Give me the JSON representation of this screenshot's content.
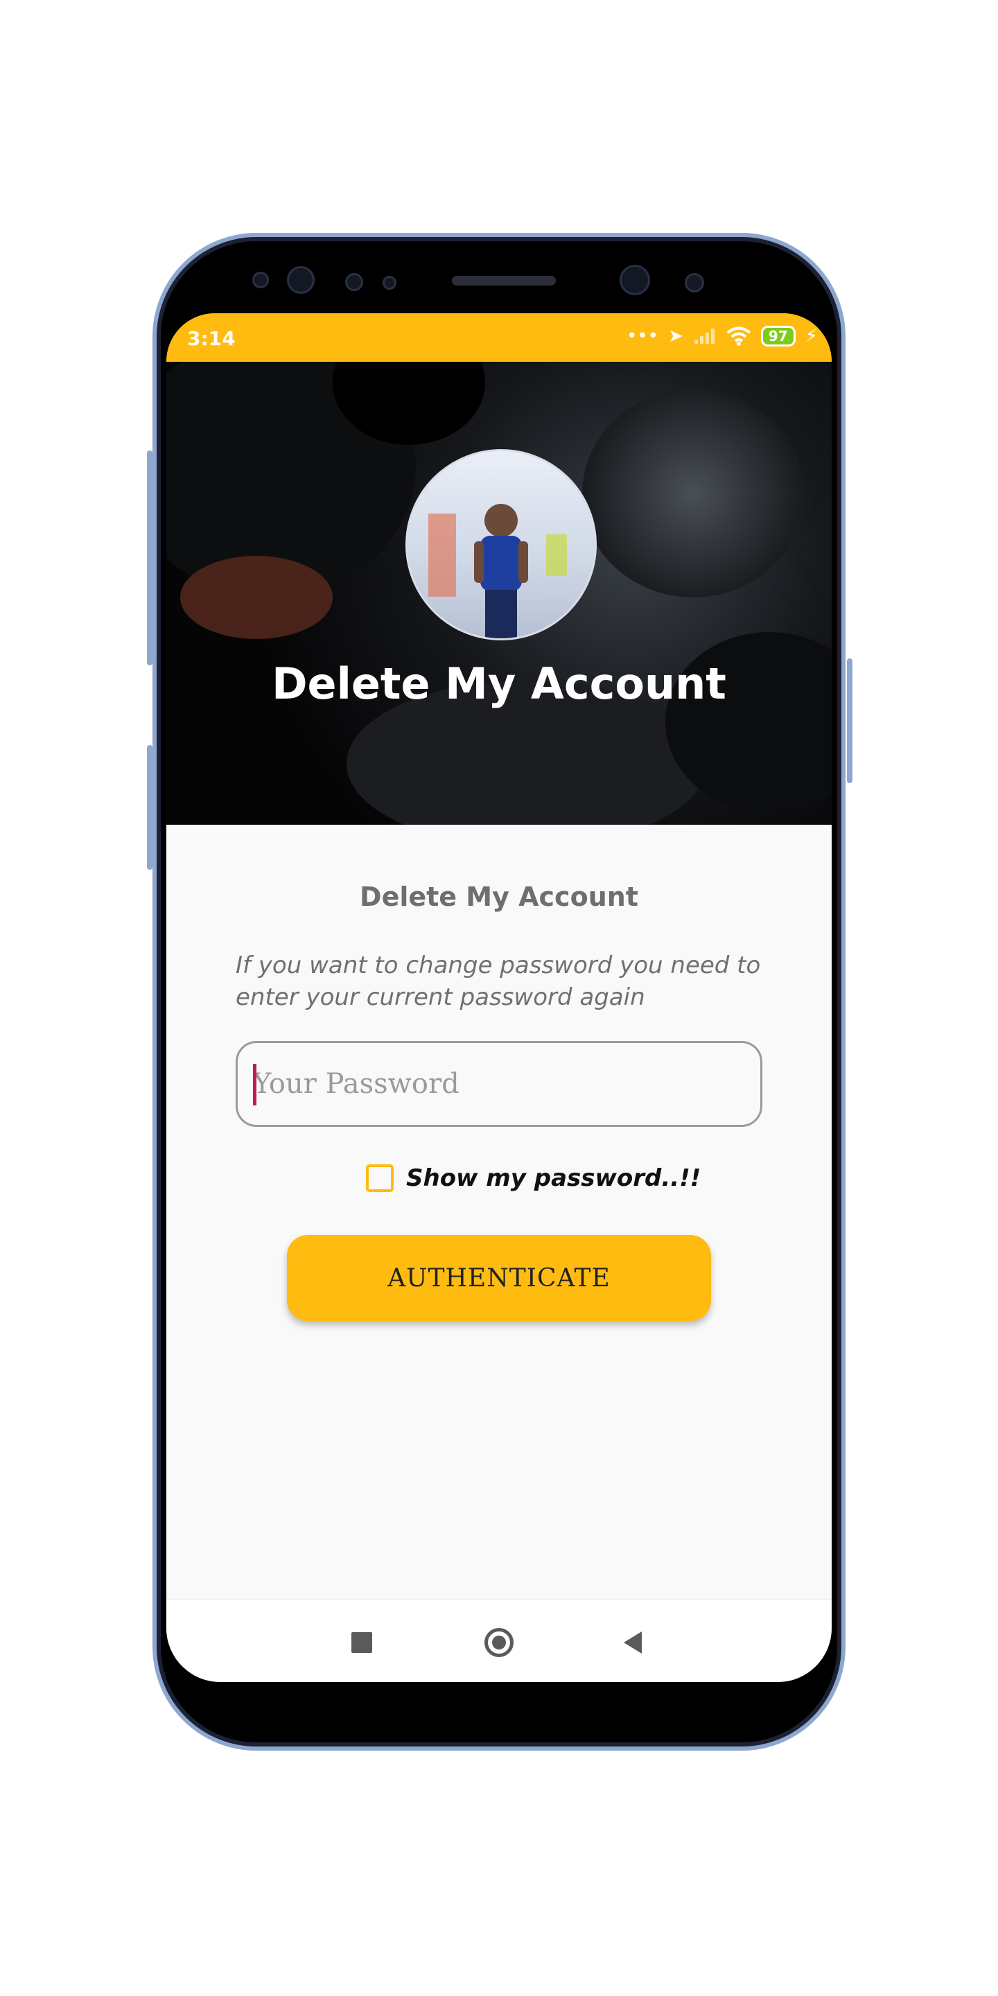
{
  "status_bar": {
    "time": "3:14",
    "battery": "97",
    "icons": [
      "more-icon",
      "location-icon",
      "signal-icon",
      "wifi-icon",
      "battery-icon",
      "charging-icon"
    ]
  },
  "hero": {
    "title": "Delete My Account"
  },
  "form": {
    "title": "Delete My Account",
    "description": "If you want to change password you need to enter your current password again",
    "password_placeholder": "Your Password",
    "password_value": "",
    "show_password_label": "Show my password..!!",
    "show_password_checked": false,
    "authenticate_label": "AUTHENTICATE"
  },
  "nav": {
    "items": [
      "recents-button",
      "home-button",
      "back-button"
    ]
  },
  "colors": {
    "accent": "#ffbb10",
    "text_muted": "#707070",
    "caret": "#c2185b"
  }
}
